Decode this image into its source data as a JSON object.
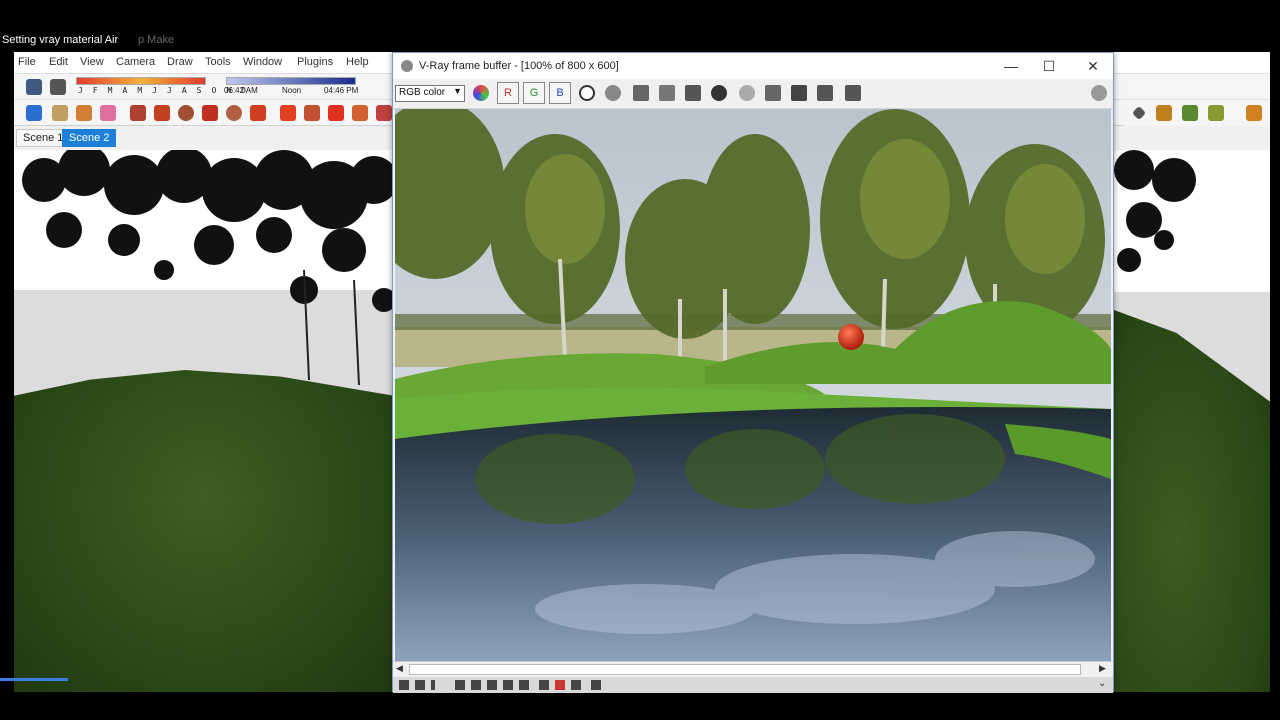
{
  "video": {
    "title": "Setting vray material Air",
    "ghost_text": "p Make"
  },
  "sketchup": {
    "menu": [
      "File",
      "Edit",
      "View",
      "Camera",
      "Draw",
      "Tools",
      "Window",
      "Plugins",
      "Help"
    ],
    "shadow": {
      "months": "J F M A M J J A S O N D",
      "time_start": "06:42 AM",
      "time_mid": "Noon",
      "time_end": "04:46 PM"
    },
    "tabs": [
      {
        "label": "Scene 1",
        "active": false
      },
      {
        "label": "Scene 2",
        "active": true
      }
    ]
  },
  "vfb": {
    "title": "V-Ray frame buffer - [100% of 800 x 600]",
    "channel": "RGB color",
    "channel_buttons": [
      "R",
      "G",
      "B"
    ]
  },
  "colors": {
    "active_tab": "#1e7fd8",
    "vfb_border": "#7a9bd0",
    "grass": "#5a9a2a",
    "water": "#3a4e63",
    "sphere": "#d8391f"
  }
}
